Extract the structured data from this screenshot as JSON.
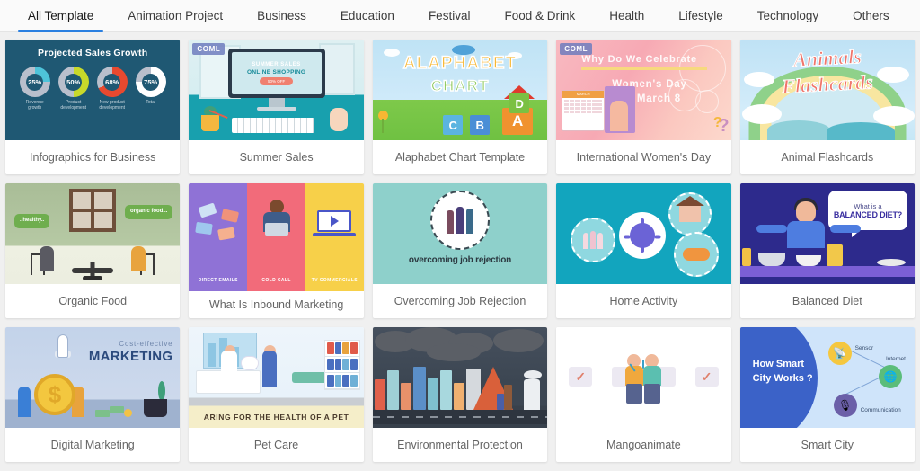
{
  "theme": {
    "accent": "#2a7fe0",
    "page_bg": "#f0f0f0",
    "tabbar_bg": "#fafafa",
    "card_bg": "#ffffff",
    "caption_color": "#656565"
  },
  "tabs": [
    {
      "label": "All Template",
      "active": true
    },
    {
      "label": "Animation Project",
      "active": false
    },
    {
      "label": "Business",
      "active": false
    },
    {
      "label": "Education",
      "active": false
    },
    {
      "label": "Festival",
      "active": false
    },
    {
      "label": "Food & Drink",
      "active": false
    },
    {
      "label": "Health",
      "active": false
    },
    {
      "label": "Lifestyle",
      "active": false
    },
    {
      "label": "Technology",
      "active": false
    },
    {
      "label": "Others",
      "active": false
    }
  ],
  "templates": [
    {
      "caption": "Infographics for Business",
      "badge": null,
      "art": {
        "title": "Projected Sales Growth",
        "donuts": [
          {
            "value": "25%",
            "label": "Revenue growth",
            "color": "#4ec3d9"
          },
          {
            "value": "50%",
            "label": "Product development",
            "color": "#c8d92a"
          },
          {
            "value": "68%",
            "label": "New product development",
            "color": "#e8492f"
          },
          {
            "value": "75%",
            "label": "Total",
            "color": "#ffffff"
          }
        ]
      }
    },
    {
      "caption": "Summer Sales",
      "badge": "COML",
      "art": {
        "screen_line1": "SUMMER SALES",
        "screen_line2": "ONLINE SHOPPING",
        "screen_button": "50% OFF"
      }
    },
    {
      "caption": "Alaphabet Chart Template",
      "badge": null,
      "art": {
        "word1": "ALAPHABET",
        "word2": "CHART",
        "blocks": [
          {
            "letter": "C",
            "color": "#5bb4e0"
          },
          {
            "letter": "B",
            "color": "#4a8ed6"
          },
          {
            "letter": "A",
            "color": "#f0922f"
          },
          {
            "letter": "D",
            "color": "#7bc043"
          }
        ]
      }
    },
    {
      "caption": "International Women's Day",
      "badge": "COML",
      "art": {
        "line1": "Why Do We Celebrate",
        "line2": "Women's Day",
        "line3": "on March 8",
        "calendar_month": "MARCH"
      }
    },
    {
      "caption": "Animal Flashcards",
      "badge": null,
      "art": {
        "word1": "Animals",
        "word2": "Flashcards"
      }
    },
    {
      "caption": "Organic Food",
      "badge": null,
      "art": {
        "bubble_left": "..healthy..",
        "bubble_right": "organic food..."
      }
    },
    {
      "caption": "What Is Inbound Marketing",
      "badge": null,
      "art": {
        "panels": [
          {
            "label": "DIRECT EMAILS",
            "color": "#8f72d6"
          },
          {
            "label": "COLD CALL",
            "color": "#f26b7a"
          },
          {
            "label": "TV COMMERCIALS",
            "color": "#f7d049"
          }
        ]
      }
    },
    {
      "caption": "Overcoming Job Rejection",
      "badge": null,
      "art": {
        "headline": "overcoming job rejection",
        "bg_color": "#8ed0cb"
      }
    },
    {
      "caption": "Home Activity",
      "badge": null,
      "art": {
        "bg_color": "#12a5be",
        "nodes": [
          "people",
          "virus",
          "house",
          "food"
        ]
      }
    },
    {
      "caption": "Balanced Diet",
      "badge": null,
      "art": {
        "bubble_line1": "What is a",
        "bubble_line2": "BALANCED DIET?",
        "bg_color": "#2d2a8c"
      }
    },
    {
      "caption": "Digital Marketing",
      "badge": null,
      "art": {
        "line1": "Cost-effective",
        "line2": "MARKETING",
        "coin_symbol": "$"
      }
    },
    {
      "caption": "Pet Care",
      "badge": null,
      "art": {
        "banner": "ARING FOR THE HEALTH OF A PET"
      }
    },
    {
      "caption": "Environmental Protection",
      "badge": null,
      "art": {
        "scene": "polluted city with storm clouds and factory"
      }
    },
    {
      "caption": "Mangoanimate",
      "badge": null,
      "art": {
        "scene": "two people high-fiving with checkmarks",
        "check_symbol": "✓"
      }
    },
    {
      "caption": "Smart City",
      "badge": null,
      "art": {
        "title_line1": "How Smart",
        "title_line2": "City Works ?",
        "nodes": [
          {
            "label": "Sensor",
            "color": "#f5c73f",
            "icon": "📡"
          },
          {
            "label": "Internet",
            "color": "#5bbd7a",
            "icon": "🌐"
          },
          {
            "label": "Communication",
            "color": "#6b5fa8",
            "icon": "🎙"
          }
        ]
      }
    }
  ]
}
